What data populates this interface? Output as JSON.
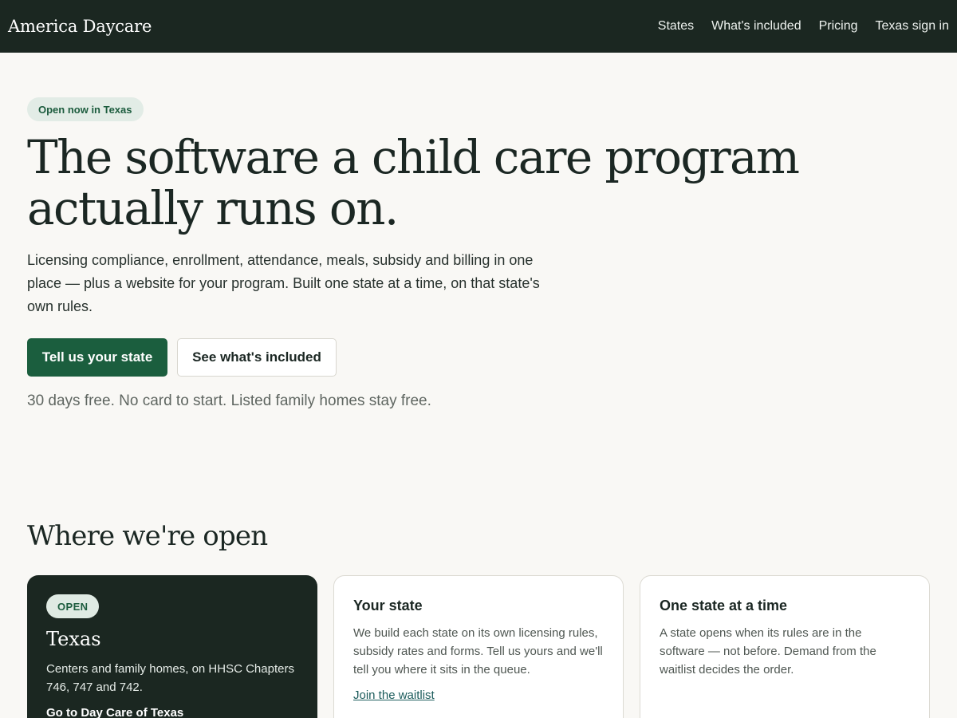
{
  "header": {
    "brand": "America Daycare",
    "nav": [
      "States",
      "What's included",
      "Pricing",
      "Texas sign in"
    ]
  },
  "hero": {
    "badge": "Open now in Texas",
    "title": "The software a child care program actually runs on.",
    "lede": "Licensing compliance, enrollment, attendance, meals, subsidy and billing in one place — plus a website for your program. Built one state at a time, on that state's own rules.",
    "primary_cta": "Tell us your state",
    "secondary_cta": "See what's included",
    "fine_print": "30 days free. No card to start. Listed family homes stay free."
  },
  "states_section": {
    "title": "Where we're open",
    "cards": [
      {
        "badge": "OPEN",
        "title": "Texas",
        "body": "Centers and family homes, on HHSC Chapters 746, 747 and 742.",
        "link": "Go to Day Care of Texas"
      },
      {
        "title": "Your state",
        "body": "We build each state on its own licensing rules, subsidy rates and forms. Tell us yours and we'll tell you where it sits in the queue.",
        "link": "Join the waitlist"
      },
      {
        "title": "One state at a time",
        "body": "A state opens when its rules are in the software — not before. Demand from the waitlist decides the order."
      }
    ]
  },
  "colors": {
    "header_bg": "#1b2721",
    "primary_green": "#1b5e3e",
    "page_bg": "#f9f8f5"
  }
}
